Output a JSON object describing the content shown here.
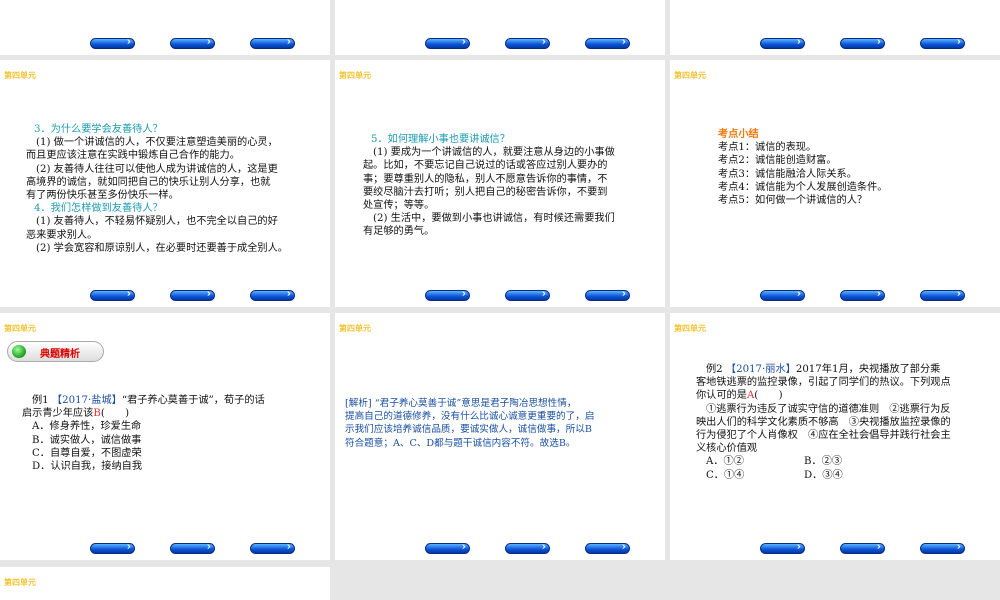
{
  "unit_label": "第四单元",
  "slide_r2c1": {
    "lines": [
      "3．为什么要学会友善待人？",
      "(1) 做一个讲诚信的人，不仅要注意塑造美丽的心灵，",
      "而且更应该注意在实践中锻炼自己合作的能力。",
      "(2) 友善待人往往可以使他人成为讲诚信的人，这是更",
      "高境界的诚信，就如同把自己的快乐让别人分享，也就",
      "有了两份快乐甚至多份快乐一样。",
      "4．我们怎样做到友善待人？",
      "(1) 友善待人，不轻易怀疑别人，也不完全以自己的好",
      "恶来要求别人。",
      "(2) 学会宽容和原谅别人，在必要时还要善于成全别人。"
    ]
  },
  "slide_r2c2": {
    "lines": [
      "5．如何理解小事也要讲诚信？",
      "(1) 要成为一个讲诚信的人，就要注意从身边的小事做",
      "起。比如，不要忘记自己说过的话或答应过别人要办的",
      "事；要尊重别人的隐私，别人不愿意告诉你的事情，不",
      "要绞尽脑汁去打听；别人把自己的秘密告诉你，不要到",
      "处宣传；等等。",
      "(2) 生活中，要做到小事也讲诚信，有时候还需要我们",
      "有足够的勇气。"
    ]
  },
  "slide_r2c3": {
    "title": "考点小结",
    "lines": [
      "考点1：诚信的表现。",
      "考点2：诚信能创造财富。",
      "考点3：诚信能融洽人际关系。",
      "考点4：诚信能为个人发展创造条件。",
      "考点5：如何做一个讲诚信的人？"
    ]
  },
  "slide_r3c1": {
    "badge": "典题精析",
    "ex": "例1",
    "src": "【2017·盐城】",
    "q1": "“君子养心莫善于诚”，荀子的话",
    "q2": "启示青少年应该",
    "ans": "B",
    "paren": "(　　)",
    "opts": [
      "A．修身养性，珍爱生命",
      "B．诚实做人，诚信做事",
      "C．自尊自爱，不图虚荣",
      "D．认识自我，接纳自我"
    ]
  },
  "slide_r3c2": {
    "lines": [
      "[解析] “君子养心莫善于诚”意思是君子陶冶思想性情，",
      "提高自己的道德修养，没有什么比诚心诚意更重要的了，启",
      "示我们应该培养诚信品质，要诚实做人，诚信做事，所以B",
      "符合题意；A、C、D都与题干诚信内容不符。故选B。"
    ]
  },
  "slide_r3c3": {
    "ex": "例2",
    "src": "【2017·丽水】",
    "q1": "2017年1月，央视播放了部分乘",
    "lines": [
      "客地铁逃票的监控录像，引起了同学们的热议。下列观点"
    ],
    "q3": "你认可的是",
    "ans": "A",
    "paren": "(　　)",
    "items": [
      "①逃票行为违反了诚实守信的道德准则　②逃票行为反",
      "映出人们的科学文化素质不够高　③央视播放监控录像的",
      "行为侵犯了个人肖像权　④应在全社会倡导并践行社会主",
      "义核心价值观"
    ],
    "opts": [
      "A．①②",
      "B．②③",
      "C．①④",
      "D．③④"
    ]
  }
}
